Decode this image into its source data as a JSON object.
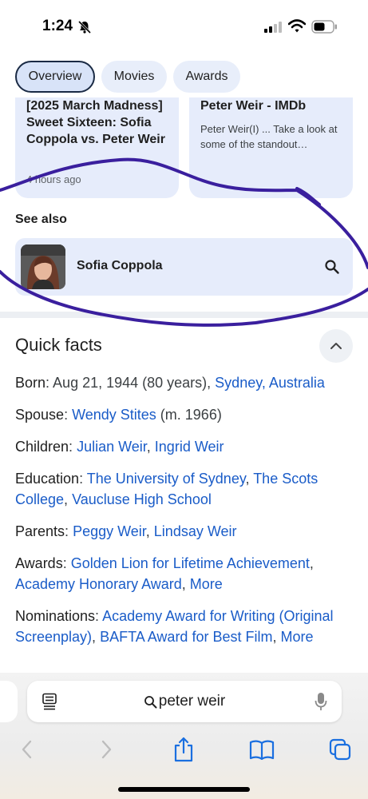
{
  "status_bar": {
    "time": "1:24"
  },
  "tabs": [
    {
      "label": "Overview",
      "active": true
    },
    {
      "label": "Movies",
      "active": false
    },
    {
      "label": "Awards",
      "active": false
    }
  ],
  "news_cards": [
    {
      "title": "[2025 March Madness] Sweet Sixteen: Sofia Coppola vs. Peter Weir",
      "meta": "4 hours ago"
    },
    {
      "title": "Peter Weir - IMDb",
      "snippet": "Peter Weir(I) ... Take a look at some of the standout…"
    }
  ],
  "see_also": {
    "label": "See also",
    "name": "Sofia Coppola"
  },
  "quick_facts": {
    "title": "Quick facts",
    "born": {
      "label": "Born",
      "text": "Aug 21, 1944 (80 years), ",
      "link": "Sydney, Australia"
    },
    "spouse": {
      "label": "Spouse",
      "link": "Wendy Stites",
      "text": " (m. 1966)"
    },
    "children": {
      "label": "Children",
      "link1": "Julian Weir",
      "link2": "Ingrid Weir"
    },
    "education": {
      "label": "Education",
      "link1": "The University of Sydney",
      "link2": "The Scots College",
      "link3": "Vaucluse High School"
    },
    "parents": {
      "label": "Parents",
      "link1": "Peggy Weir",
      "link2": "Lindsay Weir"
    },
    "awards": {
      "label": "Awards",
      "link1": "Golden Lion for Lifetime Achievement",
      "link2": "Academy Honorary Award",
      "more": "More"
    },
    "nominations": {
      "label": "Nominations",
      "link1": "Academy Award for Writing (Original Screenplay)",
      "link2": "BAFTA Award for Best Film",
      "more": "More"
    }
  },
  "browser": {
    "address": "peter weir"
  },
  "colors": {
    "link": "#1a5cc8",
    "annotation": "#3a1f9e",
    "card_bg": "#e6ecfb"
  }
}
